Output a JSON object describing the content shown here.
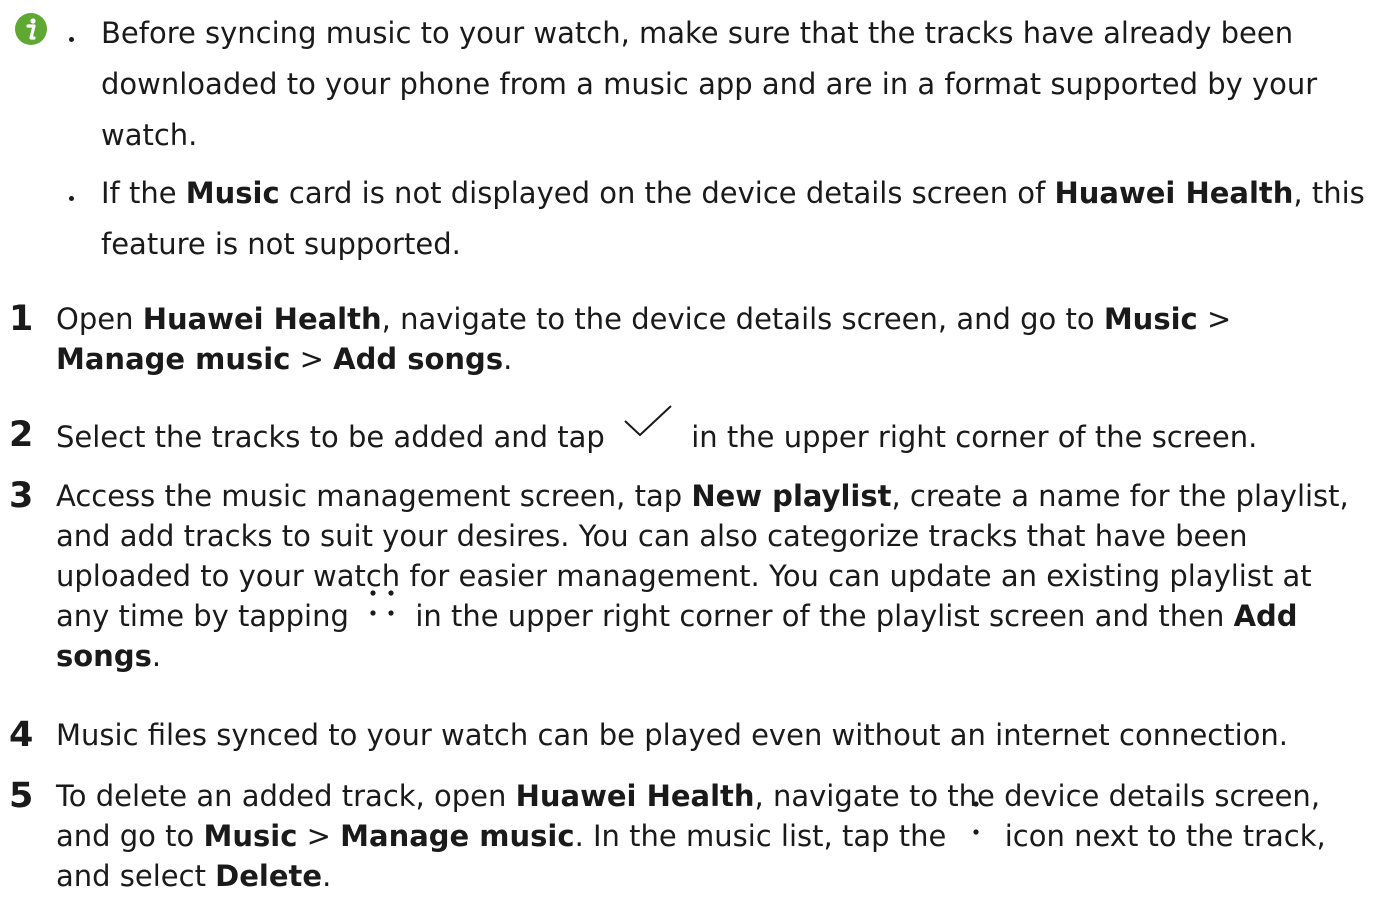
{
  "notes": [
    {
      "text": "Before syncing music to your watch, make sure that the tracks have already been downloaded to your phone from a music app and are in a format supported by your watch."
    },
    {
      "pre": "If the ",
      "b1": "Music",
      "mid": " card is not displayed on the device details screen of ",
      "b2": "Huawei Health",
      "post": ", this feature is not supported."
    }
  ],
  "steps": [
    {
      "num": "1",
      "t1": "Open ",
      "b1": "Huawei Health",
      "t2": ", navigate to the device details screen, and go to ",
      "b2": "Music",
      "t3": " > ",
      "b3": "Manage music",
      "t4": " > ",
      "b4": "Add songs",
      "t5": "."
    },
    {
      "num": "2",
      "t1": "Select the tracks to be added and tap",
      "t2": "in the upper right corner of the screen."
    },
    {
      "num": "3",
      "t1": "Access the music management screen, tap ",
      "b1": "New playlist",
      "t2": ", create a name for the playlist, and add tracks to suit your desires. You can also categorize tracks that have been uploaded to your watch for easier management. You can update an existing playlist at any time by tapping",
      "t3": "in the upper right corner of the playlist screen and then ",
      "b2": "Add songs",
      "t4": "."
    },
    {
      "num": "4",
      "t1": "Music files synced to your watch can be played even without an internet connection."
    },
    {
      "num": "5",
      "t1": "To delete an added track, open ",
      "b1": "Huawei Health",
      "t2": ", navigate to the device details screen, and go to ",
      "b2": "Music",
      "t3": " > ",
      "b3": "Manage music",
      "t4": ". In the music list, tap the",
      "t5": "icon next to the track, and select ",
      "b4": "Delete",
      "t6": "."
    }
  ],
  "icons": {
    "note": "info-icon",
    "confirm": "checkmark-icon",
    "more": "more-dots-icon",
    "track_menu": "vertical-dots-icon"
  },
  "colors": {
    "note_icon": "#5fa832",
    "text": "#1a1a1a"
  }
}
